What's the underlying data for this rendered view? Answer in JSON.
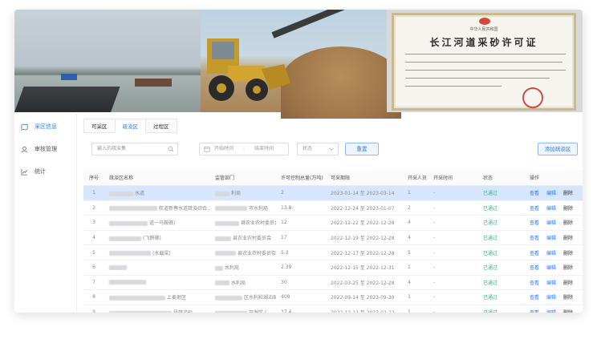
{
  "certificate": {
    "subtitle": "中华人民共和国",
    "title": "长江河道采砂许可证"
  },
  "sidebar": {
    "items": [
      {
        "label": "采区信息",
        "icon": "map-icon",
        "active": true
      },
      {
        "label": "审核管理",
        "icon": "user-icon",
        "active": false
      },
      {
        "label": "统计",
        "icon": "chart-icon",
        "active": false
      }
    ]
  },
  "tabs": [
    {
      "label": "可采区",
      "active": false
    },
    {
      "label": "疏浚区",
      "active": true
    },
    {
      "label": "过程区",
      "active": false
    }
  ],
  "filters": {
    "name_placeholder": "输入的疏浚集",
    "start_placeholder": "开始时间",
    "end_placeholder": "结束时间",
    "status_placeholder": "状态",
    "reset_label": "重置",
    "add_label": "添加疏浚区"
  },
  "table": {
    "headers": [
      "序号",
      "疏浚区名称",
      "监管部门",
      "许可控制总量(万吨)",
      "可采期限",
      "开采人员",
      "开采时间",
      "状态",
      "操作"
    ],
    "actions": {
      "view": "查看",
      "edit": "编辑",
      "delete": "删除"
    },
    "rows": [
      {
        "no": "1",
        "name": "水道",
        "dept": "利局",
        "quota": "2",
        "period": "2023-01-14 至 2023-03-14",
        "staff": "1",
        "time": "-",
        "status": "已通过"
      },
      {
        "no": "2",
        "name": "航道新春水道疏浚综合...",
        "dept": "市水利局",
        "quota": "13.8",
        "period": "2022-12-24 至 2023-01-07",
        "staff": "2",
        "time": "-",
        "status": "已通过"
      },
      {
        "no": "3",
        "name": "道一马鞍礁)",
        "dept": "县农业农村委员会",
        "quota": "12",
        "period": "2022-12-22 至 2022-12-28",
        "staff": "4",
        "time": "-",
        "status": "已通过"
      },
      {
        "no": "4",
        "name": "(飞鹅礁)",
        "dept": "县农业农村委员会",
        "quota": "17",
        "period": "2022-12-19 至 2022-12-28",
        "staff": "4",
        "time": "-",
        "status": "已通过"
      },
      {
        "no": "5",
        "name": "(水截梁)",
        "dept": "县农业农村委员会",
        "quota": "5.3",
        "period": "2022-12-17 至 2022-12-28",
        "staff": "5",
        "time": "-",
        "status": "已通过"
      },
      {
        "no": "6",
        "name": "",
        "dept": "水利局",
        "quota": "2.39",
        "period": "2022-12-15 至 2022-12-31",
        "staff": "1",
        "time": "-",
        "status": "已通过"
      },
      {
        "no": "7",
        "name": "",
        "dept": "水利局",
        "quota": "30",
        "period": "2022-03-25 至 2022-12-28",
        "staff": "4",
        "time": "-",
        "status": "已通过"
      },
      {
        "no": "8",
        "name": "上麦射区",
        "dept": "区水利和湖泊局",
        "quota": "408",
        "period": "2022-09-14 至 2023-09-30",
        "staff": "1",
        "time": "-",
        "status": "已通过"
      },
      {
        "no": "9",
        "name": "段疏浚砂...",
        "dept": "开发区 (...",
        "quota": "37.4",
        "period": "2022-12-12 至 2023-02-22",
        "staff": "1",
        "time": "-",
        "status": "已通过"
      }
    ]
  },
  "colors": {
    "accent": "#2d7bf4",
    "success": "#36b37e",
    "selected_row": "#d6e6fd"
  }
}
